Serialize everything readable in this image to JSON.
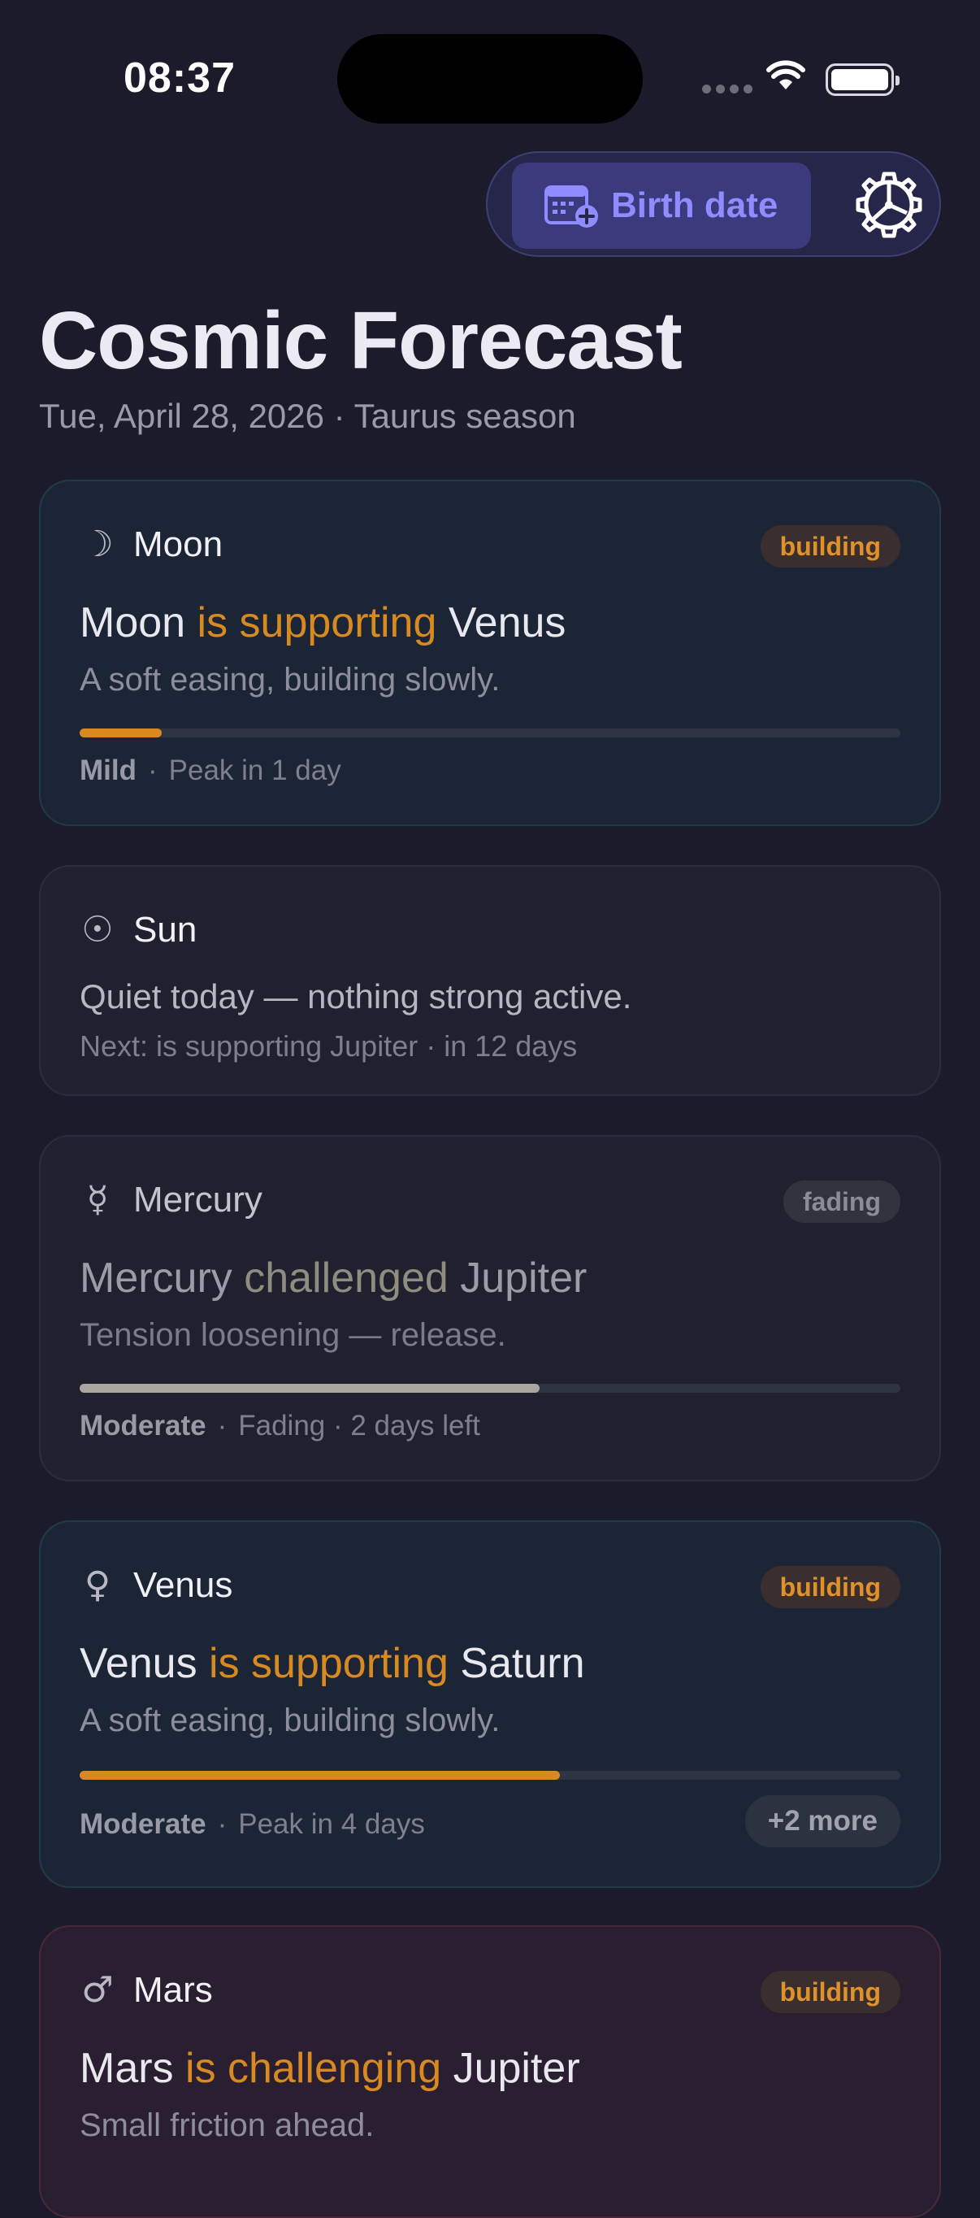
{
  "status_bar": {
    "time": "08:37"
  },
  "toolbar": {
    "birth_date_label": "Birth date"
  },
  "header": {
    "title": "Cosmic Forecast",
    "subtitle": "Tue, April 28, 2026 · Taurus season"
  },
  "cards": [
    {
      "planet": "Moon",
      "icon": "☽",
      "badge": "building",
      "subject": "Moon",
      "verb": "is supporting",
      "object": "Venus",
      "description": "A soft easing, building slowly.",
      "progress": 0.1,
      "intensity": "Mild",
      "timing": "Peak in 1 day"
    },
    {
      "planet": "Sun",
      "icon": "☉",
      "quiet_text": "Quiet today — nothing strong active.",
      "next_text": "Next: is supporting Jupiter · in 12 days"
    },
    {
      "planet": "Mercury",
      "icon": "☿",
      "badge": "fading",
      "subject": "Mercury",
      "verb": "challenged",
      "object": "Jupiter",
      "description": "Tension loosening — release.",
      "progress": 0.56,
      "intensity": "Moderate",
      "timing": "Fading · 2 days left"
    },
    {
      "planet": "Venus",
      "icon": "♀",
      "badge": "building",
      "subject": "Venus",
      "verb": "is supporting",
      "object": "Saturn",
      "description": "A soft easing, building slowly.",
      "progress": 0.585,
      "intensity": "Moderate",
      "timing": "Peak in 4 days",
      "more_label": "+2 more"
    },
    {
      "planet": "Mars",
      "icon": "♂",
      "badge": "building",
      "subject": "Mars",
      "verb": "is challenging",
      "object": "Jupiter",
      "description": "Small friction ahead."
    }
  ],
  "colors": {
    "accent": "#d88a20",
    "background": "#1b1b2b",
    "brand": "#8f8cff"
  }
}
